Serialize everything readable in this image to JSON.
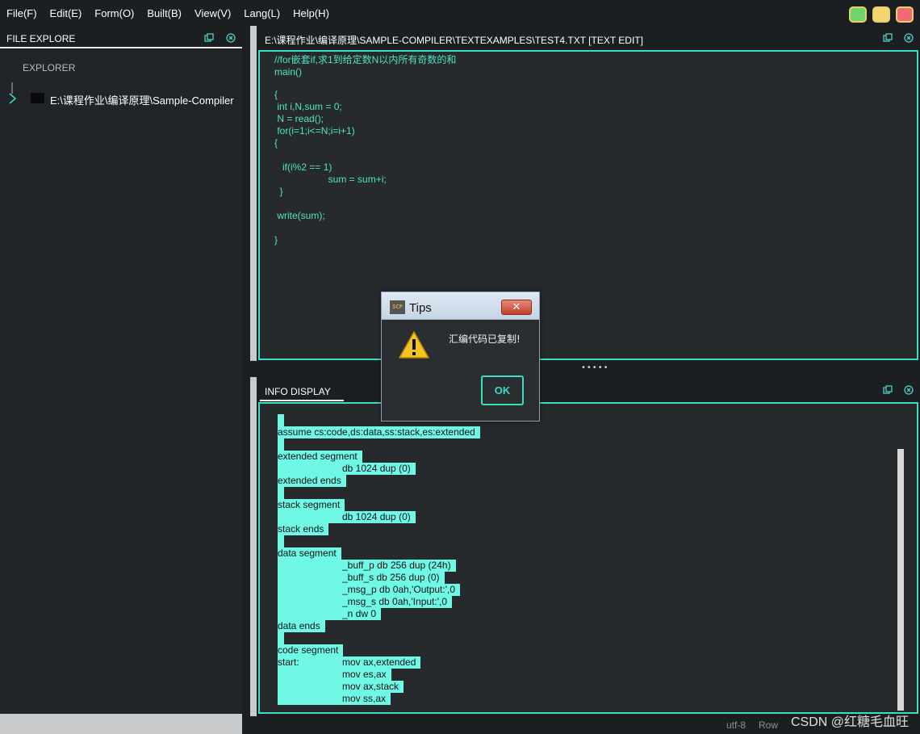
{
  "menubar": {
    "items": [
      "File(F)",
      "Edit(E)",
      "Form(O)",
      "Built(B)",
      "View(V)",
      "Lang(L)",
      "Help(H)"
    ],
    "window_buttons": [
      {
        "name": "maximize",
        "color": "#6fd46b"
      },
      {
        "name": "minimize",
        "color": "#f6d56e"
      },
      {
        "name": "close",
        "color": "#f06a73"
      }
    ]
  },
  "file_explorer": {
    "title": "FILE EXPLORE",
    "section_label": "EXPLORER",
    "tree_root": "E:\\课程作业\\编译原理\\Sample-Compiler"
  },
  "editor": {
    "title": "E:\\课程作业\\编译原理\\SAMPLE-COMPILER\\TEXTEXAMPLES\\TEST4.TXT  [TEXT EDIT]",
    "code_lines": [
      "//for嵌套if,求1到给定数N以内所有奇数的和",
      "main()",
      "",
      "{",
      " int i,N,sum = 0;",
      " N = read();",
      " for(i=1;i<=N;i=i+1)",
      "{",
      "",
      "   if(i%2 == 1)",
      "                    sum = sum+i;",
      "  }",
      "",
      " write(sum);",
      "",
      "}"
    ]
  },
  "info_display": {
    "title": "INFO DISPLAY",
    "asm_lines": [
      {
        "label": "",
        "code": ""
      },
      {
        "label": "assume cs:code,ds:data,ss:stack,es:extended",
        "code": ""
      },
      {
        "label": "",
        "code": ""
      },
      {
        "label": "extended segment",
        "code": ""
      },
      {
        "label": "",
        "code": "db 1024 dup (0)"
      },
      {
        "label": "extended ends",
        "code": ""
      },
      {
        "label": "",
        "code": ""
      },
      {
        "label": "stack segment",
        "code": ""
      },
      {
        "label": "",
        "code": "db 1024 dup (0)"
      },
      {
        "label": "stack ends",
        "code": ""
      },
      {
        "label": "",
        "code": ""
      },
      {
        "label": "data segment",
        "code": ""
      },
      {
        "label": "",
        "code": "_buff_p db 256 dup (24h)"
      },
      {
        "label": "",
        "code": "_buff_s db 256 dup (0)"
      },
      {
        "label": "",
        "code": "_msg_p db 0ah,'Output:',0"
      },
      {
        "label": "",
        "code": "_msg_s db 0ah,'Input:',0"
      },
      {
        "label": "",
        "code": "_n dw 0"
      },
      {
        "label": "data ends",
        "code": ""
      },
      {
        "label": "",
        "code": ""
      },
      {
        "label": "code segment",
        "code": ""
      },
      {
        "label": "start:",
        "code": "mov ax,extended"
      },
      {
        "label": "",
        "code": "mov es,ax"
      },
      {
        "label": "",
        "code": "mov ax,stack"
      },
      {
        "label": "",
        "code": "mov ss,ax"
      }
    ]
  },
  "statusbar": {
    "encoding": "utf-8",
    "position": "Row"
  },
  "watermark": "CSDN @红糖毛血旺",
  "dialog": {
    "title": "Tips",
    "logo_text": "SCP",
    "close_glyph": "✕",
    "message": "汇编代码已复制!",
    "ok_label": "OK"
  }
}
